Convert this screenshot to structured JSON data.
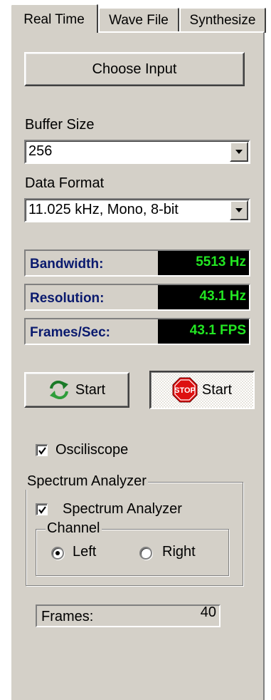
{
  "tabs": [
    {
      "label": "Real Time",
      "active": true
    },
    {
      "label": "Wave File",
      "active": false
    },
    {
      "label": "Synthesize",
      "active": false
    }
  ],
  "choose_input_label": "Choose Input",
  "buffer_size": {
    "label": "Buffer Size",
    "value": "256"
  },
  "data_format": {
    "label": "Data Format",
    "value": "11.025 kHz, Mono, 8-bit"
  },
  "readouts": [
    {
      "name": "Bandwidth:",
      "value": "5513 Hz"
    },
    {
      "name": "Resolution:",
      "value": "43.1 Hz"
    },
    {
      "name": "Frames/Sec:",
      "value": "43.1 FPS"
    }
  ],
  "start_button": {
    "label": "Start",
    "icon": "refresh-icon"
  },
  "stop_button": {
    "label": "Start",
    "icon": "stop-sign-icon",
    "icon_text": "STOP"
  },
  "oscilloscope": {
    "label": "Osciliscope",
    "checked": true
  },
  "spectrum_group": {
    "title": "Spectrum Analyzer",
    "checkbox_label": "Spectrum Analyzer",
    "checked": true,
    "channel": {
      "title": "Channel",
      "options": [
        {
          "label": "Left",
          "selected": true
        },
        {
          "label": "Right",
          "selected": false
        }
      ]
    }
  },
  "frames": {
    "label": "Frames:",
    "value": "40"
  },
  "colors": {
    "panel": "#d4d0c8",
    "readout_label": "#0a1a6e",
    "lcd_text": "#22e622",
    "lcd_bg": "#000000"
  }
}
